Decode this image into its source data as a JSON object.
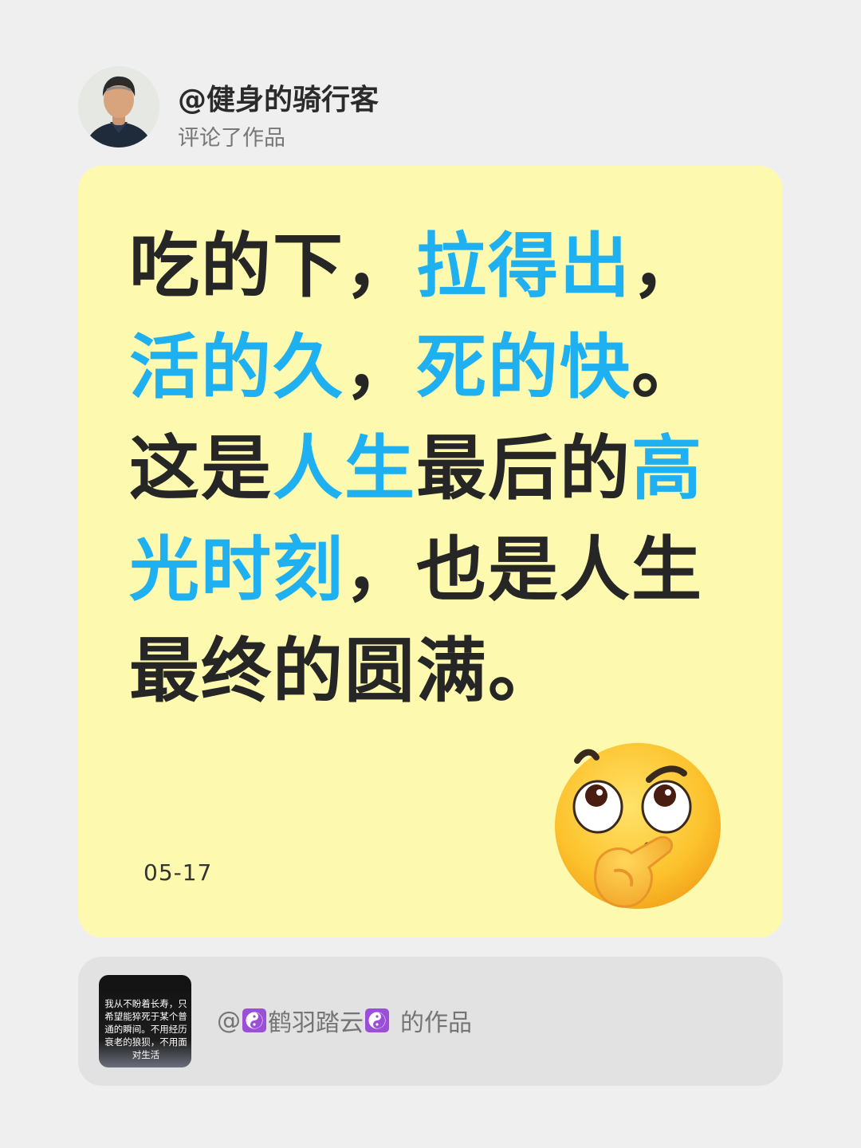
{
  "header": {
    "username": "@健身的骑行客",
    "action": "评论了作品"
  },
  "card": {
    "quote_segments": [
      {
        "text": "吃的下，",
        "highlight": false
      },
      {
        "text": "拉得出",
        "highlight": true
      },
      {
        "text": "，",
        "highlight": false
      },
      {
        "text": "活的久",
        "highlight": true
      },
      {
        "text": "，",
        "highlight": false
      },
      {
        "text": "死的快",
        "highlight": true
      },
      {
        "text": "。这是",
        "highlight": false
      },
      {
        "text": "人生",
        "highlight": true
      },
      {
        "text": "最后的",
        "highlight": false
      },
      {
        "text": "高光时刻",
        "highlight": true
      },
      {
        "text": "，也是人生最终的圆满。",
        "highlight": false
      }
    ],
    "date": "05-17",
    "emoji": "thinking-face-emoji",
    "background": "#fdfaaf",
    "highlight_color": "#1eb0f0"
  },
  "work": {
    "thumbnail_text": "我从不盼着长寿，只希望能猝死于某个普通的瞬间。不用经历衰老的狼狈，不用面对生活",
    "at": "@",
    "author_name": "鹤羽踏云",
    "suffix": "的作品",
    "author_icon": "yin-yang-icon"
  }
}
